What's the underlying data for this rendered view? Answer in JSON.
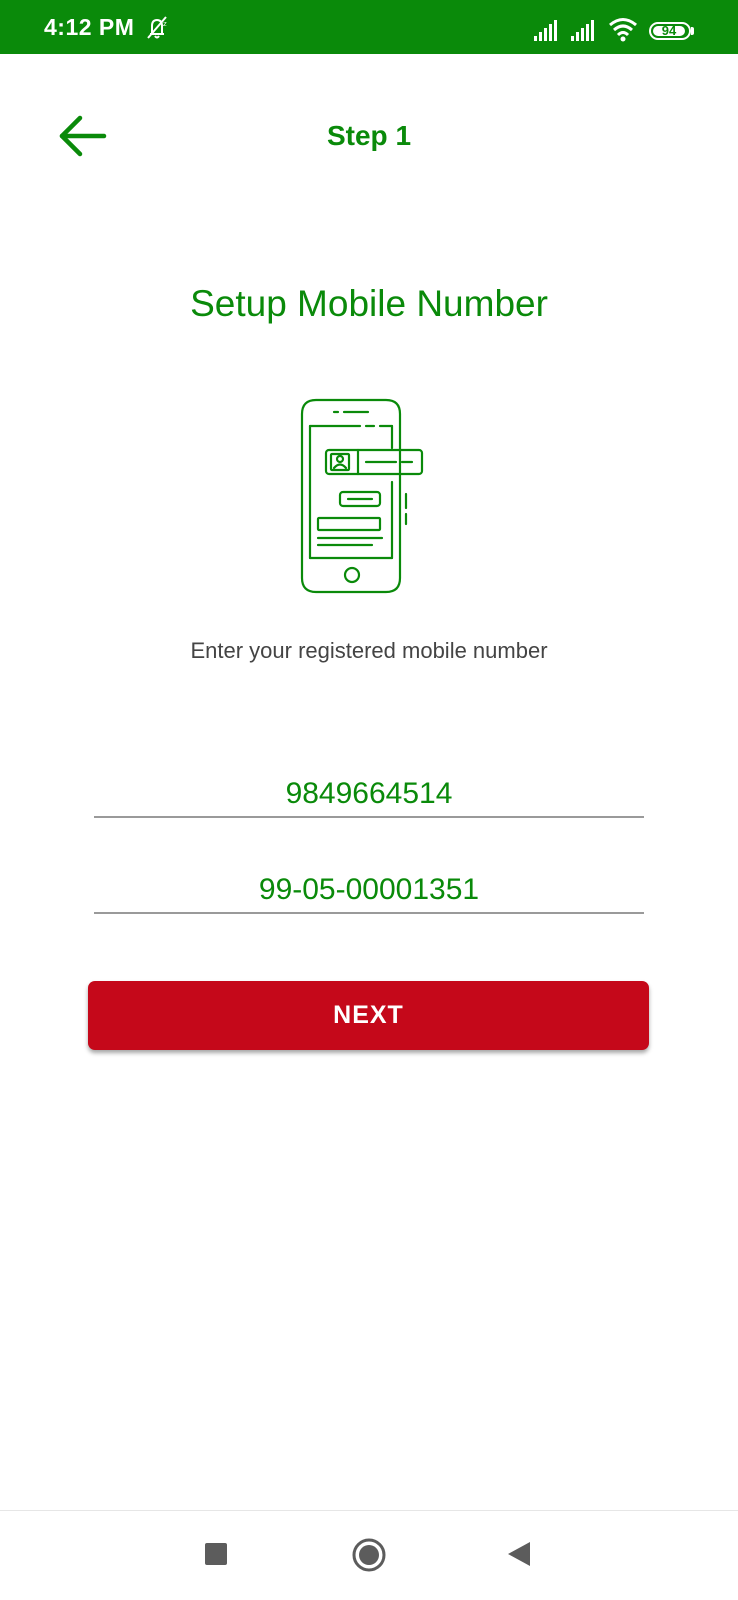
{
  "status_bar": {
    "time": "4:12 PM",
    "battery": "94",
    "icons": [
      "alarm-off-icon",
      "signal-icon",
      "signal-icon",
      "wifi-icon",
      "battery-icon"
    ]
  },
  "header": {
    "title": "Step 1",
    "back_icon": "arrow-left-icon"
  },
  "main": {
    "heading": "Setup Mobile Number",
    "illustration": "phone-illustration",
    "instruction": "Enter your registered mobile number",
    "mobile_value": "9849664514",
    "account_value": "99-05-00001351",
    "next_label": "NEXT"
  },
  "nav_bar": {
    "icons": [
      "recent-apps-icon",
      "home-icon",
      "back-triangle-icon"
    ]
  },
  "colors": {
    "brand_green": "#0a8a0a",
    "button_red": "#c5081a"
  }
}
